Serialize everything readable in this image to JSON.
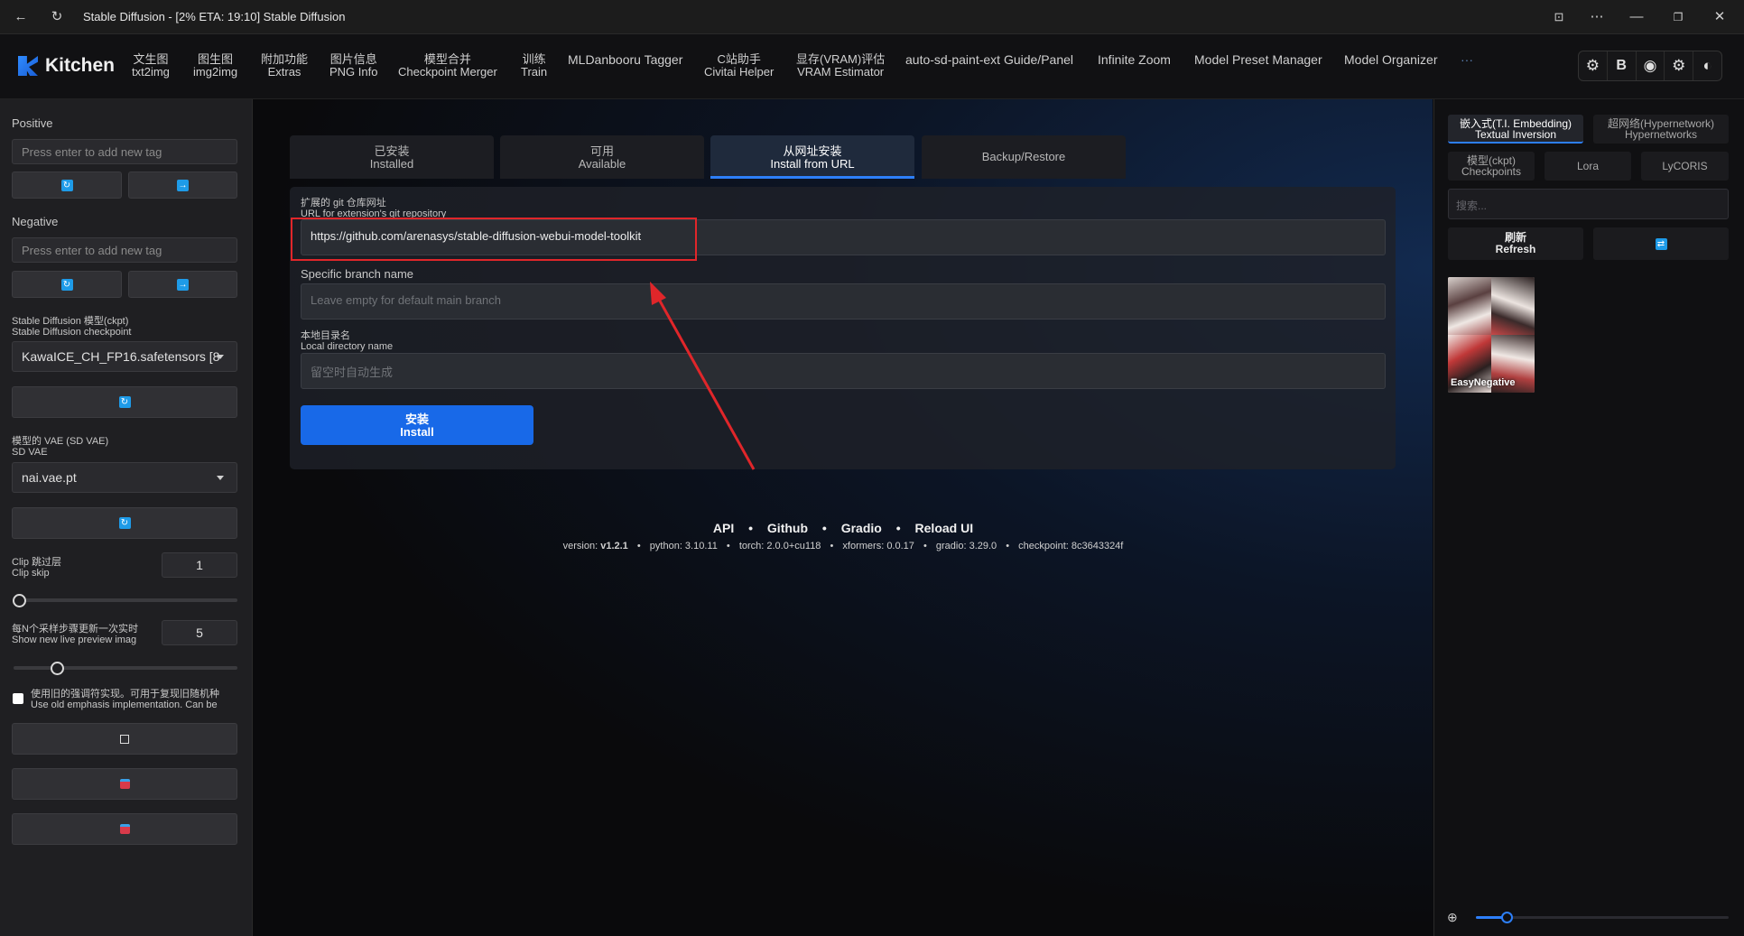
{
  "window": {
    "title": "Stable Diffusion - [2% ETA: 19:10] Stable Diffusion"
  },
  "nav": {
    "brand": "Kitchen",
    "items": [
      {
        "zh": "文生图",
        "en": "txt2img"
      },
      {
        "zh": "图生图",
        "en": "img2img"
      },
      {
        "zh": "附加功能",
        "en": "Extras"
      },
      {
        "zh": "图片信息",
        "en": "PNG Info"
      },
      {
        "zh": "模型合并",
        "en": "Checkpoint Merger"
      },
      {
        "zh": "训练",
        "en": "Train"
      },
      {
        "zh": "MLDanbooru Tagger",
        "en": ""
      },
      {
        "zh": "C站助手",
        "en": "Civitai Helper"
      },
      {
        "zh": "显存(VRAM)评估",
        "en": "VRAM Estimator"
      },
      {
        "zh": "auto-sd-paint-ext Guide/Panel",
        "en": ""
      },
      {
        "zh": "Infinite Zoom",
        "en": ""
      },
      {
        "zh": "Model Preset Manager",
        "en": ""
      },
      {
        "zh": "Model Organizer",
        "en": ""
      }
    ],
    "more": "···",
    "tools": [
      "⚙",
      "B",
      "◉",
      "⚙",
      "◐"
    ]
  },
  "left": {
    "positive_label": "Positive",
    "positive_placeholder": "Press enter to add new tag",
    "negative_label": "Negative",
    "negative_placeholder": "Press enter to add new tag",
    "ckpt_label_zh": "Stable Diffusion 模型(ckpt)",
    "ckpt_label_en": "Stable Diffusion checkpoint",
    "ckpt_value": "KawaICE_CH_FP16.safetensors [8",
    "vae_label_zh": "模型的 VAE (SD VAE)",
    "vae_label_en": "SD VAE",
    "vae_value": "nai.vae.pt",
    "clip_label_zh": "Clip 跳过层",
    "clip_label_en": "Clip skip",
    "clip_value": "1",
    "preview_label_zh": "每N个采样步骤更新一次实时",
    "preview_label_en": "Show new live preview imag",
    "preview_value": "5",
    "emphasis_zh": "使用旧的强调符实现。可用于复现旧随机种",
    "emphasis_en": "Use old emphasis implementation. Can be"
  },
  "tabs": [
    {
      "zh": "已安装",
      "en": "Installed"
    },
    {
      "zh": "可用",
      "en": "Available"
    },
    {
      "zh": "从网址安装",
      "en": "Install from URL"
    },
    {
      "zh": "Backup/Restore",
      "en": ""
    }
  ],
  "form": {
    "url_label_zh": "扩展的 git 仓库网址",
    "url_label_en": "URL for extension's git repository",
    "url_value": "https://github.com/arenasys/stable-diffusion-webui-model-toolkit",
    "branch_label": "Specific branch name",
    "branch_placeholder": "Leave empty for default main branch",
    "dir_label_zh": "本地目录名",
    "dir_label_en": "Local directory name",
    "dir_placeholder": "留空时自动生成",
    "install_zh": "安装",
    "install_en": "Install"
  },
  "footer": {
    "links": [
      "API",
      "Github",
      "Gradio",
      "Reload UI"
    ],
    "sep": "•",
    "version_label": "version:",
    "version": "v1.2.1",
    "python": "python: 3.10.11",
    "torch": "torch: 2.0.0+cu118",
    "xformers": "xformers: 0.0.17",
    "gradio": "gradio: 3.29.0",
    "checkpoint": "checkpoint: 8c3643324f"
  },
  "right": {
    "tab_ti_zh": "嵌入式(T.I. Embedding)",
    "tab_ti_en": "Textual Inversion",
    "tab_hn_zh": "超网络(Hypernetwork)",
    "tab_hn_en": "Hypernetworks",
    "tab_ckpt_zh": "模型(ckpt)",
    "tab_ckpt_en": "Checkpoints",
    "tab_lora": "Lora",
    "tab_lycoris": "LyCORIS",
    "search_placeholder": "搜索...",
    "refresh_zh": "刷新",
    "refresh_en": "Refresh",
    "card_label": "EasyNegative"
  },
  "colors": {
    "accent": "#1869e8",
    "highlight_box": "#e0262a",
    "arrow": "#e0262a"
  }
}
